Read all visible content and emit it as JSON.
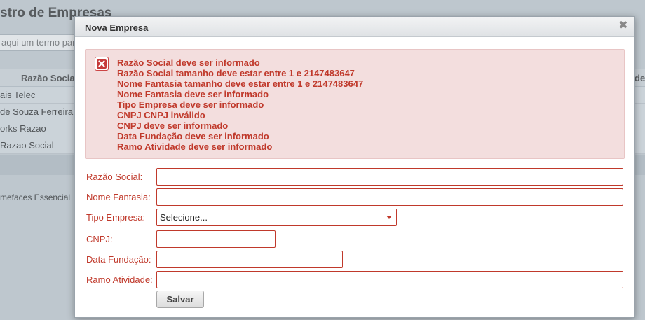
{
  "background": {
    "title": "stro de Empresas",
    "search_placeholder": "aqui um termo para",
    "table": {
      "columns": [
        "Razão Social",
        "de"
      ],
      "rows": [
        "ais Telec",
        "de Souza Ferreira",
        "orks Razao",
        "Razao Social"
      ]
    },
    "footer_text": "mefaces Essencial"
  },
  "dialog": {
    "title": "Nova Empresa",
    "close_glyph": "✖",
    "messages": [
      "Razão Social deve ser informado",
      "Razão Social tamanho deve estar entre 1 e 2147483647",
      "Nome Fantasia tamanho deve estar entre 1 e 2147483647",
      "Nome Fantasia deve ser informado",
      "Tipo Empresa deve ser informado",
      "CNPJ CNPJ inválido",
      "CNPJ deve ser informado",
      "Data Fundação deve ser informado",
      "Ramo Atividade deve ser informado"
    ],
    "fields": {
      "razao_social": {
        "label": "Razão Social:",
        "value": ""
      },
      "nome_fantasia": {
        "label": "Nome Fantasia:",
        "value": ""
      },
      "tipo_empresa": {
        "label": "Tipo Empresa:",
        "selected": "Selecione..."
      },
      "cnpj": {
        "label": "CNPJ:",
        "value": ""
      },
      "data_fundacao": {
        "label": "Data Fundação:",
        "value": ""
      },
      "ramo_atividade": {
        "label": "Ramo Atividade:",
        "value": ""
      }
    },
    "save_label": "Salvar"
  },
  "colors": {
    "error_text": "#c0392b",
    "error_bg": "#f3dede"
  }
}
